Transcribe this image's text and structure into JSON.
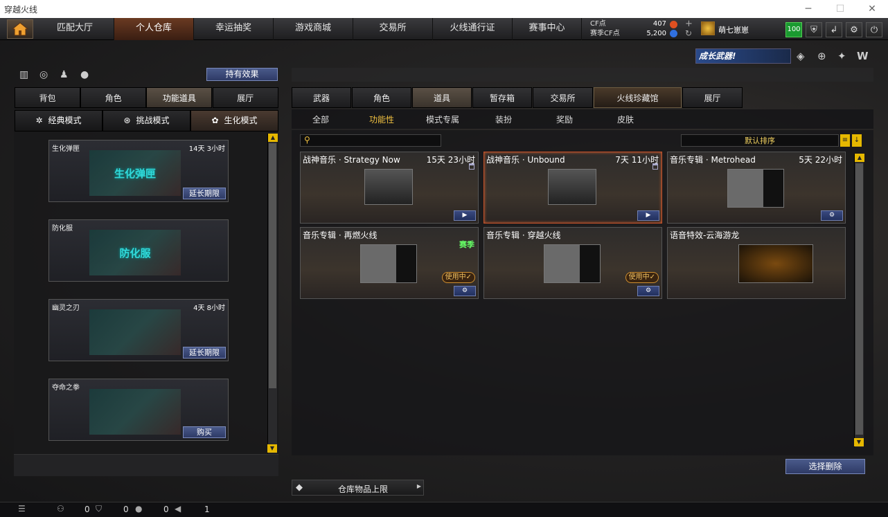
{
  "window": {
    "title": "穿越火线",
    "minimize": "─",
    "maximize": "☐",
    "close": "✕"
  },
  "nav": {
    "tabs": [
      "匹配大厅",
      "个人仓库",
      "幸运抽奖",
      "游戏商城",
      "交易所",
      "火线通行证",
      "赛事中心"
    ],
    "active": 1
  },
  "currency": {
    "cf_label": "CF点",
    "cf_value": "407",
    "season_label": "赛季CF点",
    "season_value": "5,200"
  },
  "user": {
    "name": "萌七崽崽",
    "level": "100"
  },
  "banner": {
    "text": "成长武器!"
  },
  "left": {
    "effects_button": "持有效果",
    "tabs": [
      "背包",
      "角色",
      "功能道具",
      "展厅"
    ],
    "active_tab": 2,
    "modes": [
      "经典模式",
      "挑战模式",
      "生化模式"
    ],
    "active_mode": 2,
    "items": [
      {
        "name": "生化弹匣",
        "time": "14天 3小时",
        "art": "生化弹匣",
        "button": "延长期限"
      },
      {
        "name": "防化服",
        "time": "",
        "art": "防化服",
        "button": ""
      },
      {
        "name": "幽灵之刃",
        "time": "4天 8小时",
        "art": "",
        "button": "延长期限"
      },
      {
        "name": "夺命之拳",
        "time": "",
        "art": "",
        "button": "购买"
      }
    ]
  },
  "right": {
    "tabs": [
      "武器",
      "角色",
      "道具",
      "暂存箱",
      "交易所",
      "火线珍藏馆",
      "展厅"
    ],
    "active_tab": 2,
    "highlight_tab": 5,
    "subtabs": [
      "全部",
      "功能性",
      "模式专属",
      "装扮",
      "奖励",
      "皮肤"
    ],
    "active_subtab": 1,
    "search_placeholder": "",
    "sort_label": "默认排序",
    "items": [
      {
        "name": "战神音乐 · Strategy Now",
        "time": "15天 23小时",
        "tag": "",
        "status": "",
        "button": "▶"
      },
      {
        "name": "战神音乐 · Unbound",
        "time": "7天 11小时",
        "tag": "",
        "status": "",
        "button": "▶"
      },
      {
        "name": "音乐专辑 · Metrohead",
        "time": "5天 22小时",
        "tag": "",
        "status": "",
        "button": "⚙"
      },
      {
        "name": "音乐专辑 · 再燃火线",
        "time": "",
        "tag": "赛季",
        "status": "使用中✓",
        "button": "⚙"
      },
      {
        "name": "音乐专辑 · 穿越火线",
        "time": "",
        "tag": "",
        "status": "使用中✓",
        "button": "⚙"
      },
      {
        "name": "语音特效-云海游龙",
        "time": "",
        "tag": "",
        "status": "",
        "button": ""
      }
    ],
    "batch_delete": "选择删除",
    "capacity": "仓库物品上限"
  },
  "statusbar": {
    "count1": "0",
    "count2": "0",
    "count3": "0",
    "count4": "1"
  }
}
